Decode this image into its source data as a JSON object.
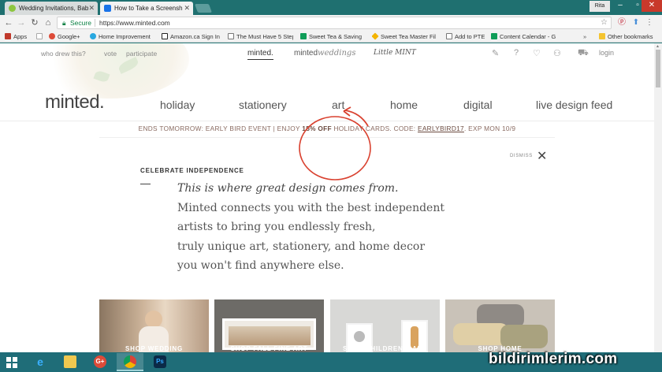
{
  "browser": {
    "tabs": [
      {
        "title": "Wedding Invitations, Bab",
        "favicon_color": "#8dc63f"
      },
      {
        "title": "How to Take a Screensh",
        "favicon_color": "#1a73e8"
      }
    ],
    "user_label": "Rita",
    "url_secure_label": "Secure",
    "url": "https://www.minted.com",
    "bookmarks": [
      {
        "label": "Apps",
        "color": "#c0392b"
      },
      {
        "label": "",
        "color": "#aaa"
      },
      {
        "label": "Google+",
        "color": "#dd4b39"
      },
      {
        "label": "Home Improvement",
        "color": "#29a8e0"
      },
      {
        "label": "Amazon.ca Sign In",
        "color": "#222"
      },
      {
        "label": "The Must Have 5 Step",
        "color": "#777"
      },
      {
        "label": "Sweet Tea & Saving",
        "color": "#0f9d58"
      },
      {
        "label": "Sweet Tea Master Fil",
        "color": "#f4b400"
      },
      {
        "label": "Add to PTE",
        "color": "#777"
      },
      {
        "label": "Content Calendar - G",
        "color": "#0f9d58"
      },
      {
        "label": "Other bookmarks",
        "color": "#f4c430"
      }
    ]
  },
  "site": {
    "util_links": {
      "who_drew": "who drew this?",
      "vote": "vote",
      "participate": "participate"
    },
    "brand_tabs": {
      "minted": "minted.",
      "weddings_a": "minted",
      "weddings_b": "weddings",
      "little": "Little MINT"
    },
    "login": "login",
    "logo": "minted.",
    "nav": [
      "holiday",
      "stationery",
      "art",
      "home",
      "digital",
      "live design feed"
    ],
    "promo": {
      "prefix": "ENDS TOMORROW: EARLY BIRD EVENT | ENJOY ",
      "highlight": "15% OFF",
      "middle": " HOLIDAY CARDS. CODE: ",
      "code": "EARLYBIRD17",
      "suffix": ". EXP MON 10/9"
    },
    "dismiss": "DISMISS",
    "hero": {
      "eyebrow": "CELEBRATE INDEPENDENCE",
      "headline": "This is where great design comes from.",
      "lines": [
        "Minted connects you with the best independent",
        "artists to bring you endlessly fresh,",
        "truly unique art, stationery, and home decor",
        "you won't find anywhere else."
      ]
    },
    "tiles": [
      {
        "label": "SHOP WEDDING"
      },
      {
        "label": "SHOP FALL FINE ART"
      },
      {
        "label": "SHOP CHILDREN'S ART"
      },
      {
        "label": "SHOP HOME"
      }
    ]
  },
  "taskbar": {
    "watermark": "bildirimlerim.com"
  },
  "colors": {
    "chrome_frame": "#1f7070",
    "taskbar": "#1f6d78",
    "annotation_red": "#d9412f",
    "promo_text": "#8a6b61"
  }
}
